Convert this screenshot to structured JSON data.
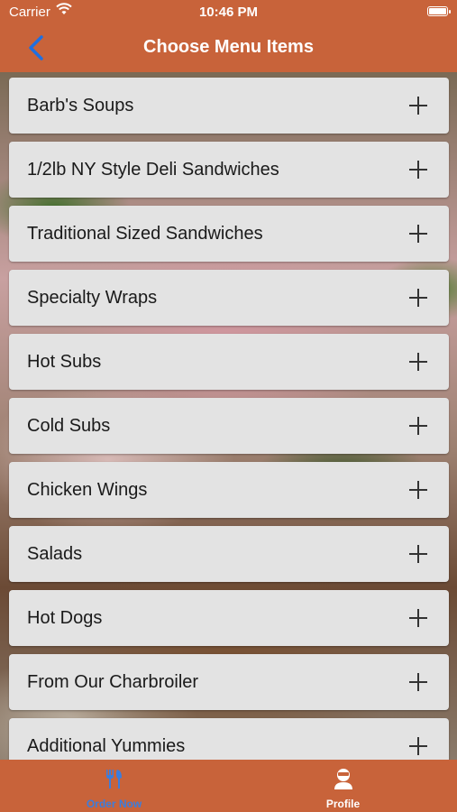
{
  "status_bar": {
    "carrier": "Carrier",
    "time": "10:46 PM"
  },
  "nav": {
    "title": "Choose Menu Items",
    "back_icon": "chevron-left-icon"
  },
  "menu": {
    "items": [
      {
        "label": "Barb's Soups"
      },
      {
        "label": "1/2lb NY Style Deli Sandwiches"
      },
      {
        "label": "Traditional Sized Sandwiches"
      },
      {
        "label": "Specialty Wraps"
      },
      {
        "label": "Hot Subs"
      },
      {
        "label": "Cold Subs"
      },
      {
        "label": "Chicken Wings"
      },
      {
        "label": "Salads"
      },
      {
        "label": "Hot Dogs"
      },
      {
        "label": "From Our Charbroiler"
      },
      {
        "label": "Additional Yummies"
      }
    ],
    "expand_icon": "plus-icon"
  },
  "tabs": {
    "order_now": {
      "label": "Order Now",
      "icon": "utensils-icon",
      "selected": true
    },
    "profile": {
      "label": "Profile",
      "icon": "person-icon",
      "selected": false
    }
  },
  "colors": {
    "bar": "#c8633a",
    "accent": "#3b7ddd",
    "row_background": "#e3e3e3"
  }
}
